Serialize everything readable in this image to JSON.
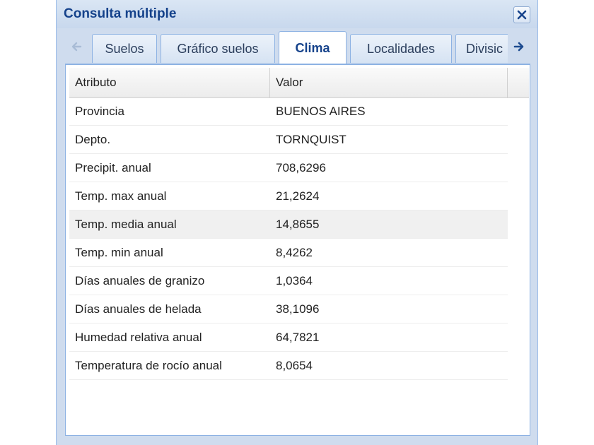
{
  "window": {
    "title": "Consulta múltiple"
  },
  "tabs": [
    {
      "label": "Suelos"
    },
    {
      "label": "Gráfico suelos"
    },
    {
      "label": "Clima"
    },
    {
      "label": "Localidades"
    },
    {
      "label": "Divisic"
    }
  ],
  "grid": {
    "columns": [
      "Atributo",
      "Valor"
    ],
    "rows": [
      {
        "attr": "Provincia",
        "value": "BUENOS AIRES"
      },
      {
        "attr": "Depto.",
        "value": "TORNQUIST"
      },
      {
        "attr": "Precipit. anual",
        "value": "708,6296"
      },
      {
        "attr": "Temp. max anual",
        "value": "21,2624"
      },
      {
        "attr": "Temp. media anual",
        "value": "14,8655"
      },
      {
        "attr": "Temp. min anual",
        "value": "8,4262"
      },
      {
        "attr": "Días anuales de granizo",
        "value": "1,0364"
      },
      {
        "attr": "Días anuales de helada",
        "value": "38,1096"
      },
      {
        "attr": "Humedad relativa anual",
        "value": "64,7821"
      },
      {
        "attr": "Temperatura de rocío anual",
        "value": "8,0654"
      }
    ]
  },
  "colors": {
    "title": "#15428b",
    "accent": "#3b6fb6",
    "frame": "#cfdcee"
  }
}
